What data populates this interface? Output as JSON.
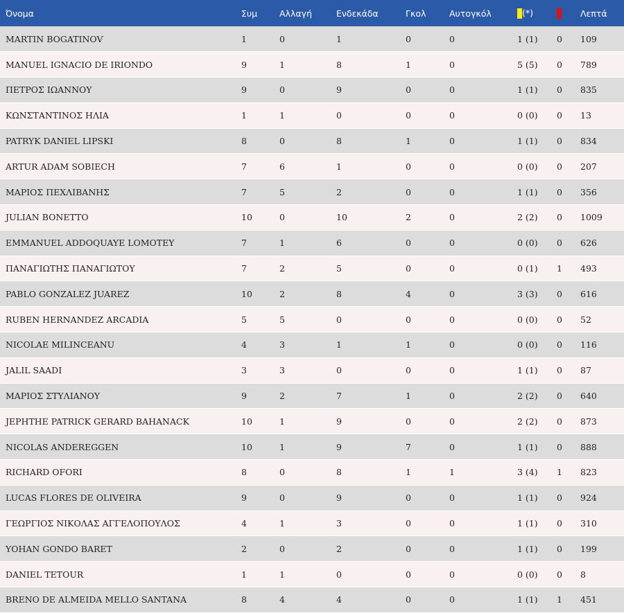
{
  "colors": {
    "header_bg": "#2b5ba8",
    "row_odd": "#dcdcdc",
    "row_even": "#f9f0f0",
    "yellow_card": "#ffee00",
    "red_card": "#e01010"
  },
  "header": {
    "name": "Όνομα",
    "apps": "Συμ",
    "subs": "Αλλαγή",
    "starts": "Ενδεκάδα",
    "goals": "Γκολ",
    "own_goals": "Αυτογκόλ",
    "yellow_icon": "yellow-card-icon",
    "yellow_suffix": "(*)",
    "red_icon": "red-card-icon",
    "minutes": "Λεπτά"
  },
  "players": [
    {
      "name": "MARTIN BOGATINOV",
      "apps": "1",
      "subs": "0",
      "starts": "1",
      "goals": "0",
      "own_goals": "0",
      "yellow": "1 (1)",
      "red": "0",
      "minutes": "109"
    },
    {
      "name": "MANUEL IGNACIO DE IRIONDO",
      "apps": "9",
      "subs": "1",
      "starts": "8",
      "goals": "1",
      "own_goals": "0",
      "yellow": "5 (5)",
      "red": "0",
      "minutes": "789"
    },
    {
      "name": "ΠΕΤΡΟΣ ΙΩΑΝΝΟΥ",
      "apps": "9",
      "subs": "0",
      "starts": "9",
      "goals": "0",
      "own_goals": "0",
      "yellow": "1 (1)",
      "red": "0",
      "minutes": "835"
    },
    {
      "name": "ΚΩΝΣΤΑΝΤΙΝΟΣ ΗΛΙΑ",
      "apps": "1",
      "subs": "1",
      "starts": "0",
      "goals": "0",
      "own_goals": "0",
      "yellow": "0 (0)",
      "red": "0",
      "minutes": "13"
    },
    {
      "name": "PATRYK DANIEL LIPSKI",
      "apps": "8",
      "subs": "0",
      "starts": "8",
      "goals": "1",
      "own_goals": "0",
      "yellow": "1 (1)",
      "red": "0",
      "minutes": "834"
    },
    {
      "name": "ARTUR ADAM SOBIECH",
      "apps": "7",
      "subs": "6",
      "starts": "1",
      "goals": "0",
      "own_goals": "0",
      "yellow": "0 (0)",
      "red": "0",
      "minutes": "207"
    },
    {
      "name": "ΜΑΡΙΟΣ ΠΕΧΛΙΒΑΝΗΣ",
      "apps": "7",
      "subs": "5",
      "starts": "2",
      "goals": "0",
      "own_goals": "0",
      "yellow": "1 (1)",
      "red": "0",
      "minutes": "356"
    },
    {
      "name": "JULIAN BONETTO",
      "apps": "10",
      "subs": "0",
      "starts": "10",
      "goals": "2",
      "own_goals": "0",
      "yellow": "2 (2)",
      "red": "0",
      "minutes": "1009"
    },
    {
      "name": "EMMANUEL ADDOQUAYE LOMOTEY",
      "apps": "7",
      "subs": "1",
      "starts": "6",
      "goals": "0",
      "own_goals": "0",
      "yellow": "0 (0)",
      "red": "0",
      "minutes": "626"
    },
    {
      "name": "ΠΑΝΑΓΙΩΤΗΣ ΠΑΝΑΓΙΩΤΟΥ",
      "apps": "7",
      "subs": "2",
      "starts": "5",
      "goals": "0",
      "own_goals": "0",
      "yellow": "0 (1)",
      "red": "1",
      "minutes": "493"
    },
    {
      "name": "PABLO GONZALEZ JUAREZ",
      "apps": "10",
      "subs": "2",
      "starts": "8",
      "goals": "4",
      "own_goals": "0",
      "yellow": "3 (3)",
      "red": "0",
      "minutes": "616"
    },
    {
      "name": "RUBEN HERNANDEZ ARCADIA",
      "apps": "5",
      "subs": "5",
      "starts": "0",
      "goals": "0",
      "own_goals": "0",
      "yellow": "0 (0)",
      "red": "0",
      "minutes": "52"
    },
    {
      "name": "NICOLAE MILINCEANU",
      "apps": "4",
      "subs": "3",
      "starts": "1",
      "goals": "1",
      "own_goals": "0",
      "yellow": "0 (0)",
      "red": "0",
      "minutes": "116"
    },
    {
      "name": "JALIL SAADI",
      "apps": "3",
      "subs": "3",
      "starts": "0",
      "goals": "0",
      "own_goals": "0",
      "yellow": "1 (1)",
      "red": "0",
      "minutes": "87"
    },
    {
      "name": "ΜΑΡΙΟΣ ΣΤΥΛΙΑΝΟΥ",
      "apps": "9",
      "subs": "2",
      "starts": "7",
      "goals": "1",
      "own_goals": "0",
      "yellow": "2 (2)",
      "red": "0",
      "minutes": "640"
    },
    {
      "name": "JEPHTHE PATRICK GERARD BAHANACK",
      "apps": "10",
      "subs": "1",
      "starts": "9",
      "goals": "0",
      "own_goals": "0",
      "yellow": "2 (2)",
      "red": "0",
      "minutes": "873"
    },
    {
      "name": "NICOLAS ANDEREGGEN",
      "apps": "10",
      "subs": "1",
      "starts": "9",
      "goals": "7",
      "own_goals": "0",
      "yellow": "1 (1)",
      "red": "0",
      "minutes": "888"
    },
    {
      "name": "RICHARD OFORI",
      "apps": "8",
      "subs": "0",
      "starts": "8",
      "goals": "1",
      "own_goals": "1",
      "yellow": "3 (4)",
      "red": "1",
      "minutes": "823"
    },
    {
      "name": "LUCAS FLORES DE OLIVEIRA",
      "apps": "9",
      "subs": "0",
      "starts": "9",
      "goals": "0",
      "own_goals": "0",
      "yellow": "1 (1)",
      "red": "0",
      "minutes": "924"
    },
    {
      "name": "ΓΕΩΡΓΙΟΣ ΝΙΚΟΛΑΣ ΑΓΓΕΛΟΠΟΥΛΟΣ",
      "apps": "4",
      "subs": "1",
      "starts": "3",
      "goals": "0",
      "own_goals": "0",
      "yellow": "1 (1)",
      "red": "0",
      "minutes": "310"
    },
    {
      "name": "YOHAN GONDO BARET",
      "apps": "2",
      "subs": "0",
      "starts": "2",
      "goals": "0",
      "own_goals": "0",
      "yellow": "1 (1)",
      "red": "0",
      "minutes": "199"
    },
    {
      "name": "DANIEL TETOUR",
      "apps": "1",
      "subs": "1",
      "starts": "0",
      "goals": "0",
      "own_goals": "0",
      "yellow": "0 (0)",
      "red": "0",
      "minutes": "8"
    },
    {
      "name": "BRENO DE ALMEIDA MELLO SANTANA",
      "apps": "8",
      "subs": "4",
      "starts": "4",
      "goals": "0",
      "own_goals": "0",
      "yellow": "1 (1)",
      "red": "1",
      "minutes": "451"
    }
  ]
}
